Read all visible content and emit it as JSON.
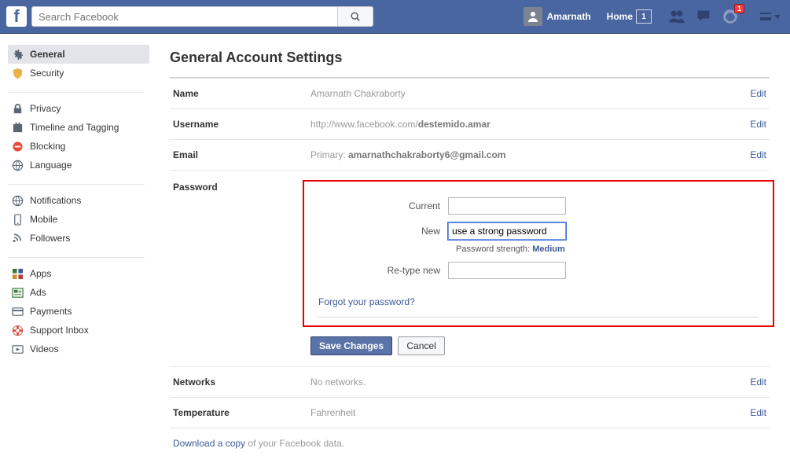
{
  "top": {
    "search_placeholder": "Search Facebook",
    "user_name": "Amarnath",
    "home_label": "Home",
    "home_count": "1",
    "notif_count": "1"
  },
  "sidebar": {
    "groups": [
      {
        "items": [
          {
            "id": "general",
            "label": "General",
            "icon": "gear",
            "active": true
          },
          {
            "id": "security",
            "label": "Security",
            "icon": "shield",
            "active": false
          }
        ]
      },
      {
        "items": [
          {
            "id": "privacy",
            "label": "Privacy",
            "icon": "lock"
          },
          {
            "id": "timeline",
            "label": "Timeline and Tagging",
            "icon": "cal"
          },
          {
            "id": "blocking",
            "label": "Blocking",
            "icon": "block"
          },
          {
            "id": "language",
            "label": "Language",
            "icon": "globe"
          }
        ]
      },
      {
        "items": [
          {
            "id": "notifications",
            "label": "Notifications",
            "icon": "globe"
          },
          {
            "id": "mobile",
            "label": "Mobile",
            "icon": "mobile"
          },
          {
            "id": "followers",
            "label": "Followers",
            "icon": "rss"
          }
        ]
      },
      {
        "items": [
          {
            "id": "apps",
            "label": "Apps",
            "icon": "apps"
          },
          {
            "id": "ads",
            "label": "Ads",
            "icon": "ads"
          },
          {
            "id": "payments",
            "label": "Payments",
            "icon": "card"
          },
          {
            "id": "support",
            "label": "Support Inbox",
            "icon": "life"
          },
          {
            "id": "videos",
            "label": "Videos",
            "icon": "video"
          }
        ]
      }
    ]
  },
  "page": {
    "title": "General Account Settings",
    "rows": {
      "name": {
        "label": "Name",
        "value": "Amarnath Chakraborty",
        "edit": "Edit"
      },
      "username": {
        "label": "Username",
        "prefix": "http://www.facebook.com/",
        "value": "destemido.amar",
        "edit": "Edit"
      },
      "email": {
        "label": "Email",
        "prefix": "Primary: ",
        "value": "amarnathchakraborty6@gmail.com",
        "edit": "Edit"
      },
      "networks": {
        "label": "Networks",
        "value": "No networks.",
        "edit": "Edit"
      },
      "temperature": {
        "label": "Temperature",
        "value": "Fahrenheit",
        "edit": "Edit"
      }
    },
    "password": {
      "label": "Password",
      "current_label": "Current",
      "new_label": "New",
      "new_value": "use a strong password",
      "strength_prefix": "Password strength: ",
      "strength_value": "Medium",
      "retype_label": "Re-type new",
      "forgot_link": "Forgot your password?",
      "save_btn": "Save Changes",
      "cancel_btn": "Cancel"
    },
    "download": {
      "link": "Download a copy",
      "rest": " of your Facebook data."
    }
  }
}
